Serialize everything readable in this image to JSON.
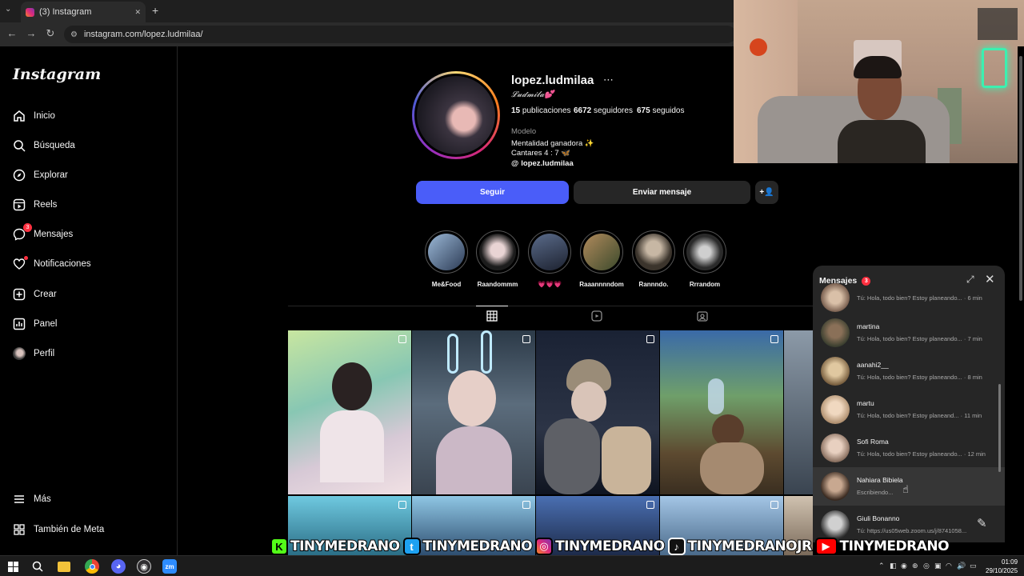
{
  "browser": {
    "tab_title": "(3) Instagram",
    "url": "instagram.com/lopez.ludmilaa/",
    "new_tab": "+",
    "close_tab": "✕"
  },
  "sidebar": {
    "logo": "Instagram",
    "items": [
      {
        "label": "Inicio",
        "icon": "home-icon"
      },
      {
        "label": "Búsqueda",
        "icon": "search-icon"
      },
      {
        "label": "Explorar",
        "icon": "compass-icon"
      },
      {
        "label": "Reels",
        "icon": "reels-icon"
      },
      {
        "label": "Mensajes",
        "icon": "messenger-icon",
        "badge": "3"
      },
      {
        "label": "Notificaciones",
        "icon": "heart-icon"
      },
      {
        "label": "Crear",
        "icon": "plus-square-icon"
      },
      {
        "label": "Panel",
        "icon": "chart-icon"
      },
      {
        "label": "Perfil",
        "icon": "avatar-icon"
      }
    ],
    "more": "Más",
    "meta": "También de Meta"
  },
  "profile": {
    "username": "lopez.ludmilaa",
    "display_name": "𝓛𝓾𝓭𝓶𝓲𝓵𝓪💕",
    "posts_count": "15",
    "posts_label": "publicaciones",
    "followers_count": "6672",
    "followers_label": "seguidores",
    "following_count": "675",
    "following_label": "seguidos",
    "category": "Modelo",
    "bio_line1": "Mentalidad ganadora ✨",
    "bio_line2": "Cantares 4 : 7 🦋",
    "threads_handle": "lopez.ludmilaa",
    "follow_button": "Seguir",
    "message_button": "Enviar mensaje"
  },
  "highlights": [
    {
      "label": "Me&Food"
    },
    {
      "label": "Raandommm"
    },
    {
      "label": "💗💗💗"
    },
    {
      "label": "Raaannnndom"
    },
    {
      "label": "Rannndo."
    },
    {
      "label": "Rrrandom"
    }
  ],
  "messages_panel": {
    "title": "Mensajes",
    "badge": "3",
    "conversations": [
      {
        "name": "",
        "preview": "Tú: Hola, todo bien? Estoy planeando...",
        "time": "6 min"
      },
      {
        "name": "martina",
        "preview": "Tú: Hola, todo bien? Estoy planeando...",
        "time": "7 min"
      },
      {
        "name": "aanahi2__",
        "preview": "Tú: Hola, todo bien? Estoy planeando...",
        "time": "8 min"
      },
      {
        "name": "martu",
        "preview": "Tú: Hola, todo bien? Estoy planeand...",
        "time": "11 min"
      },
      {
        "name": "Sofi Roma",
        "preview": "Tú: Hola, todo bien? Estoy planeando...",
        "time": "12 min"
      },
      {
        "name": "Nahiara Bibiela",
        "preview": "Escribiendo...",
        "time": ""
      },
      {
        "name": "Giuli Bonanno",
        "preview": "Tú: https://us05web.zoom.us/j/8741058...",
        "time": ""
      }
    ]
  },
  "banner": {
    "items": [
      {
        "text": "TINYMEDRANO",
        "icon": "kick-icon",
        "color": "#53fc18"
      },
      {
        "text": "TINYMEDRANO",
        "icon": "twitter-icon",
        "color": "#1da1f2"
      },
      {
        "text": "TINYMEDRANO",
        "icon": "instagram-icon",
        "color": "#d62976"
      },
      {
        "text": "TINYMEDRANOJR",
        "icon": "tiktok-icon",
        "color": "#000000"
      },
      {
        "text": "TINYMEDRANO",
        "icon": "youtube-icon",
        "color": "#ff0000"
      }
    ]
  },
  "taskbar": {
    "time": "01:09",
    "date": "29/10/2025"
  },
  "colors": {
    "follow_button": "#4a5df9",
    "badge": "#ff3040",
    "background": "#000000"
  }
}
